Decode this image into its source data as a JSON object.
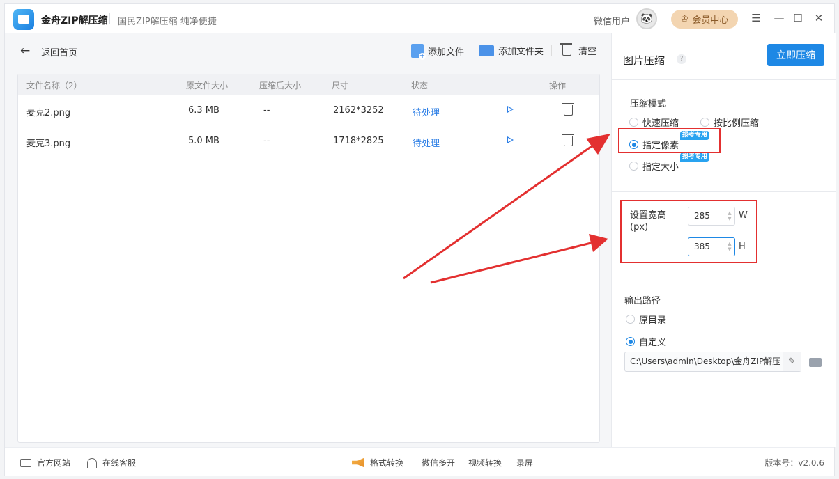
{
  "titlebar": {
    "app_name": "金舟ZIP解压缩",
    "slogan": "国民ZIP解压缩 纯净便捷",
    "user_name": "微信用户",
    "vip_label": "会员中心"
  },
  "toolbar": {
    "back_label": "返回首页",
    "add_file": "添加文件",
    "add_folder": "添加文件夹",
    "clear": "清空"
  },
  "table": {
    "headers": [
      "文件名称（2）",
      "原文件大小",
      "压缩后大小",
      "尺寸",
      "状态",
      "操作"
    ],
    "rows": [
      {
        "name": "麦克2.png",
        "orig_size": "6.3 MB",
        "comp_size": "--",
        "dims": "2162*3252",
        "status": "待处理"
      },
      {
        "name": "麦克3.png",
        "orig_size": "5.0 MB",
        "comp_size": "--",
        "dims": "1718*2825",
        "status": "待处理"
      }
    ]
  },
  "panel": {
    "title": "图片压缩",
    "help": "?",
    "compress_button": "立即压缩",
    "mode_label": "压缩模式",
    "mode_options": [
      "快速压缩",
      "按比例压缩",
      "指定像素",
      "指定大小"
    ],
    "selected_mode": "指定像素",
    "badge_text": "报考专用",
    "size_label_line1": "设置宽高",
    "size_label_line2": "(px)",
    "width_value": "285",
    "width_unit": "W",
    "height_value": "385",
    "height_unit": "H",
    "output_label": "输出路径",
    "output_options": [
      "原目录",
      "自定义"
    ],
    "selected_output": "自定义",
    "output_path": "C:\\Users\\admin\\Desktop\\金舟ZIP解压"
  },
  "statusbar": {
    "website": "官方网站",
    "support": "在线客服",
    "format": "格式转换",
    "wechat_multi": "微信多开",
    "video_convert": "视频转换",
    "record": "录屏",
    "version": "版本号：v2.0.6"
  },
  "colors": {
    "accent": "#1e88e5",
    "annotation_red": "#e33030",
    "vip_bg": "#f3d5b1"
  }
}
